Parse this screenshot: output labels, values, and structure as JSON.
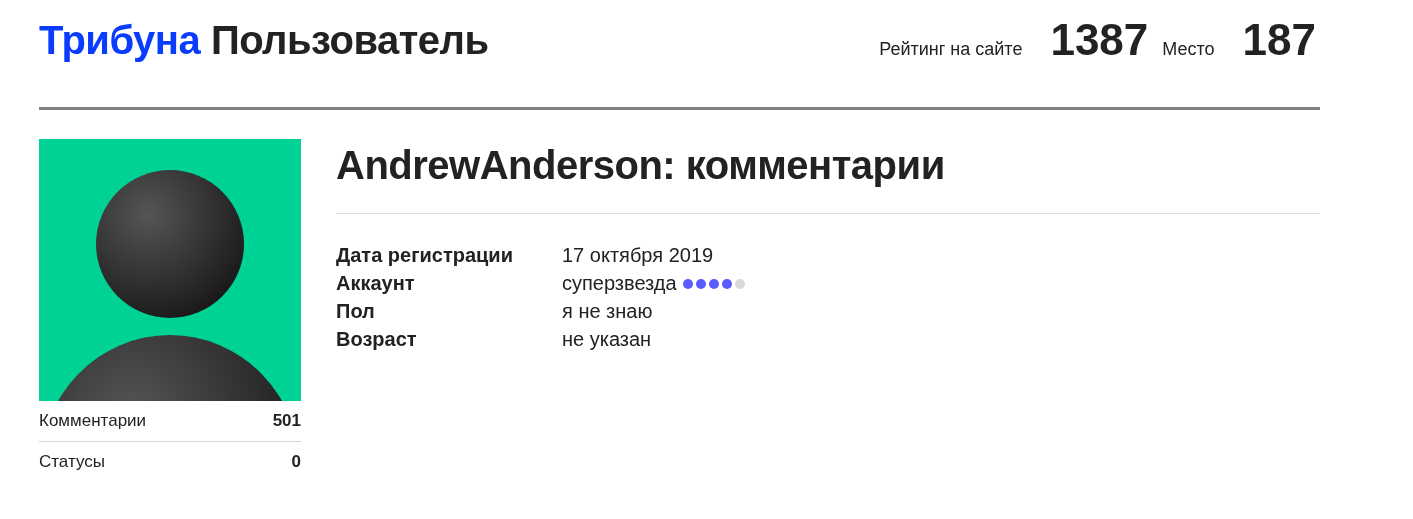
{
  "header": {
    "brand": "Трибуна",
    "title": "Пользователь",
    "rating_label": "Рейтинг на сайте",
    "rating": "1387",
    "place_label": "Место",
    "place": "187"
  },
  "sidebar": {
    "stats": [
      {
        "label": "Комментарии",
        "value": "501"
      },
      {
        "label": "Статусы",
        "value": "0"
      }
    ]
  },
  "profile": {
    "heading": "AndrewAnderson: комментарии",
    "info": [
      {
        "label": "Дата регистрации",
        "value": "17 октября 2019"
      },
      {
        "label": "Аккаунт",
        "value": "суперзвезда",
        "stars": 4
      },
      {
        "label": "Пол",
        "value": "я не знаю"
      },
      {
        "label": "Возраст",
        "value": "не указан"
      }
    ]
  }
}
